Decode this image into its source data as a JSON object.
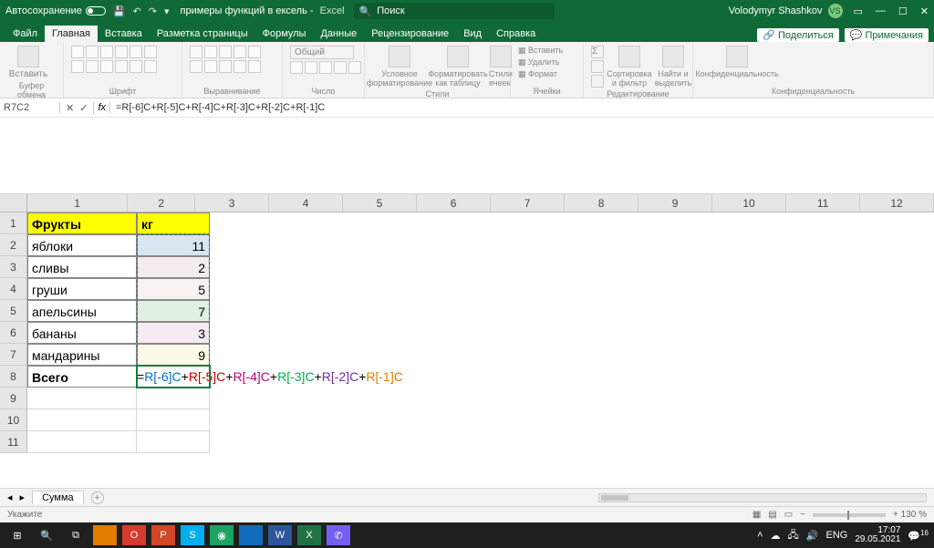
{
  "titlebar": {
    "autosave": "Автосохранение",
    "doc_name": "примеры функций в ексель",
    "app": "Excel",
    "search_placeholder": "Поиск",
    "user": "Volodymyr Shashkov",
    "initials": "VS"
  },
  "tabs": [
    "Файл",
    "Главная",
    "Вставка",
    "Разметка страницы",
    "Формулы",
    "Данные",
    "Рецензирование",
    "Вид",
    "Справка"
  ],
  "active_tab": "Главная",
  "share": "Поделиться",
  "comments": "Примечания",
  "ribbon": {
    "paste": "Вставить",
    "groups": [
      "Буфер обмена",
      "Шрифт",
      "Выравнивание",
      "Число",
      "Стили",
      "Ячейки",
      "Редактирование",
      "Конфиденциальность"
    ],
    "number_fmt": "Общий",
    "cond_fmt": "Условное форматирование",
    "as_table": "Форматировать как таблицу",
    "cell_styles": "Стили ячеек",
    "insert": "Вставить",
    "delete": "Удалить",
    "format": "Формат",
    "sort": "Сортировка и фильтр",
    "find": "Найти и выделить",
    "conf": "Конфиденциальность"
  },
  "namebox": "R7C2",
  "formula": "=R[-6]C+R[-5]C+R[-4]C+R[-3]C+R[-2]C+R[-1]C",
  "cols": [
    "1",
    "2",
    "3",
    "4",
    "5",
    "6",
    "7",
    "8",
    "9",
    "10",
    "11",
    "12"
  ],
  "rows": [
    "1",
    "2",
    "3",
    "4",
    "5",
    "6",
    "7",
    "8",
    "9",
    "10",
    "11"
  ],
  "data": {
    "A1": "Фрукты",
    "B1": "кг",
    "A2": "яблоки",
    "B2": "11",
    "A3": "сливы",
    "B3": "2",
    "A4": "груши",
    "B4": "5",
    "A5": "апельсины",
    "B5": "7",
    "A6": "бананы",
    "B6": "3",
    "A7": "мандарины",
    "B7": "9",
    "A8": "Всего"
  },
  "editing_formula": {
    "p0": "=",
    "p1": "R[-6]C",
    "p2": "+",
    "p3": "R[-5]C",
    "p4": "+",
    "p5": "R[-4]C",
    "p6": "+",
    "p7": "R[-3]C",
    "p8": "+",
    "p9": "R[-2]C",
    "p10": "+",
    "p11": "R[-1]C"
  },
  "sheet": "Сумма",
  "statusbar": {
    "mode": "Укажите",
    "zoom": "+ 130 %"
  },
  "taskbar": {
    "lang": "ENG",
    "time": "17:07",
    "date": "29.05.2021",
    "notif": "16"
  }
}
